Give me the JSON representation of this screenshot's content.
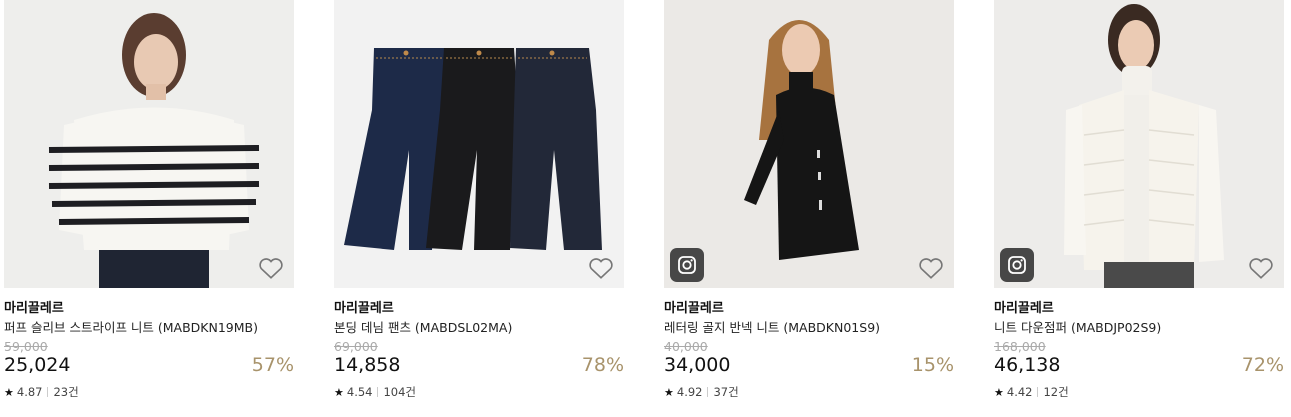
{
  "products": [
    {
      "brand": "마리끌레르",
      "name": "퍼프 슬리브 스트라이프 니트 (MABDKN19MB)",
      "original_price": "59,000",
      "price": "25,024",
      "discount": "57%",
      "rating": "4.87",
      "reviews": "23건",
      "has_instagram": false,
      "image": "woman-striped-knit-sweater"
    },
    {
      "brand": "마리끌레르",
      "name": "본딩 데님 팬츠 (MABDSL02MA)",
      "original_price": "69,000",
      "price": "14,858",
      "discount": "78%",
      "rating": "4.54",
      "reviews": "104건",
      "has_instagram": false,
      "image": "three-denim-pants"
    },
    {
      "brand": "마리끌레르",
      "name": "레터링 골지 반넥 니트 (MABDKN01S9)",
      "original_price": "40,000",
      "price": "34,000",
      "discount": "15%",
      "rating": "4.92",
      "reviews": "37건",
      "has_instagram": true,
      "image": "woman-black-lettering-knit"
    },
    {
      "brand": "마리끌레르",
      "name": "니트 다운점퍼 (MABDJP02S9)",
      "original_price": "168,000",
      "price": "46,138",
      "discount": "72%",
      "rating": "4.42",
      "reviews": "12건",
      "has_instagram": true,
      "image": "woman-white-down-jumper"
    }
  ],
  "colors": {
    "discount": "#a8936b",
    "original_price": "#aaaaaa",
    "instagram_badge": "#474747"
  },
  "icons": {
    "wishlist": "heart-outline-icon",
    "instagram": "instagram-icon",
    "rating": "star-icon"
  }
}
